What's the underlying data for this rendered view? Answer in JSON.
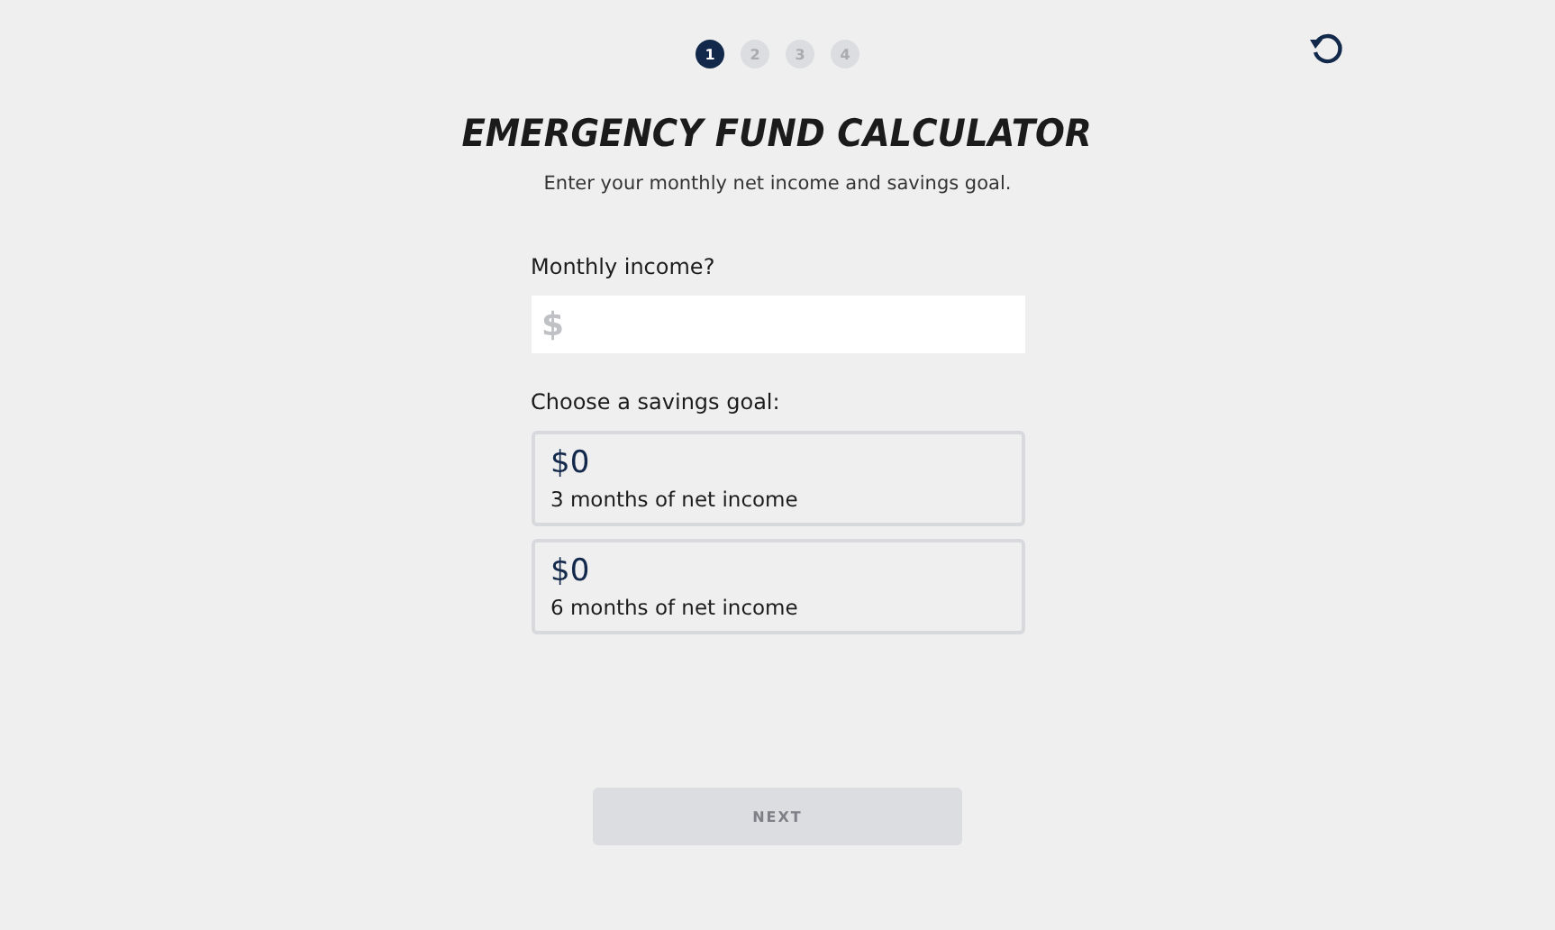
{
  "steps": [
    {
      "label": "1",
      "selected": true
    },
    {
      "label": "2",
      "selected": false
    },
    {
      "label": "3",
      "selected": false
    },
    {
      "label": "4",
      "selected": false
    }
  ],
  "title": "EMERGENCY FUND CALCULATOR",
  "subtitle": "Enter your monthly net income and savings goal.",
  "income": {
    "label": "Monthly income?",
    "placeholder": "$"
  },
  "goals": {
    "label": "Choose a savings goal:",
    "options": [
      {
        "amount": "$0",
        "description": "3 months of net income",
        "selected": false
      },
      {
        "amount": "$0",
        "description": "6 months of net income",
        "selected": false
      }
    ]
  },
  "next_button": {
    "label": "NEXT",
    "disabled": true
  }
}
